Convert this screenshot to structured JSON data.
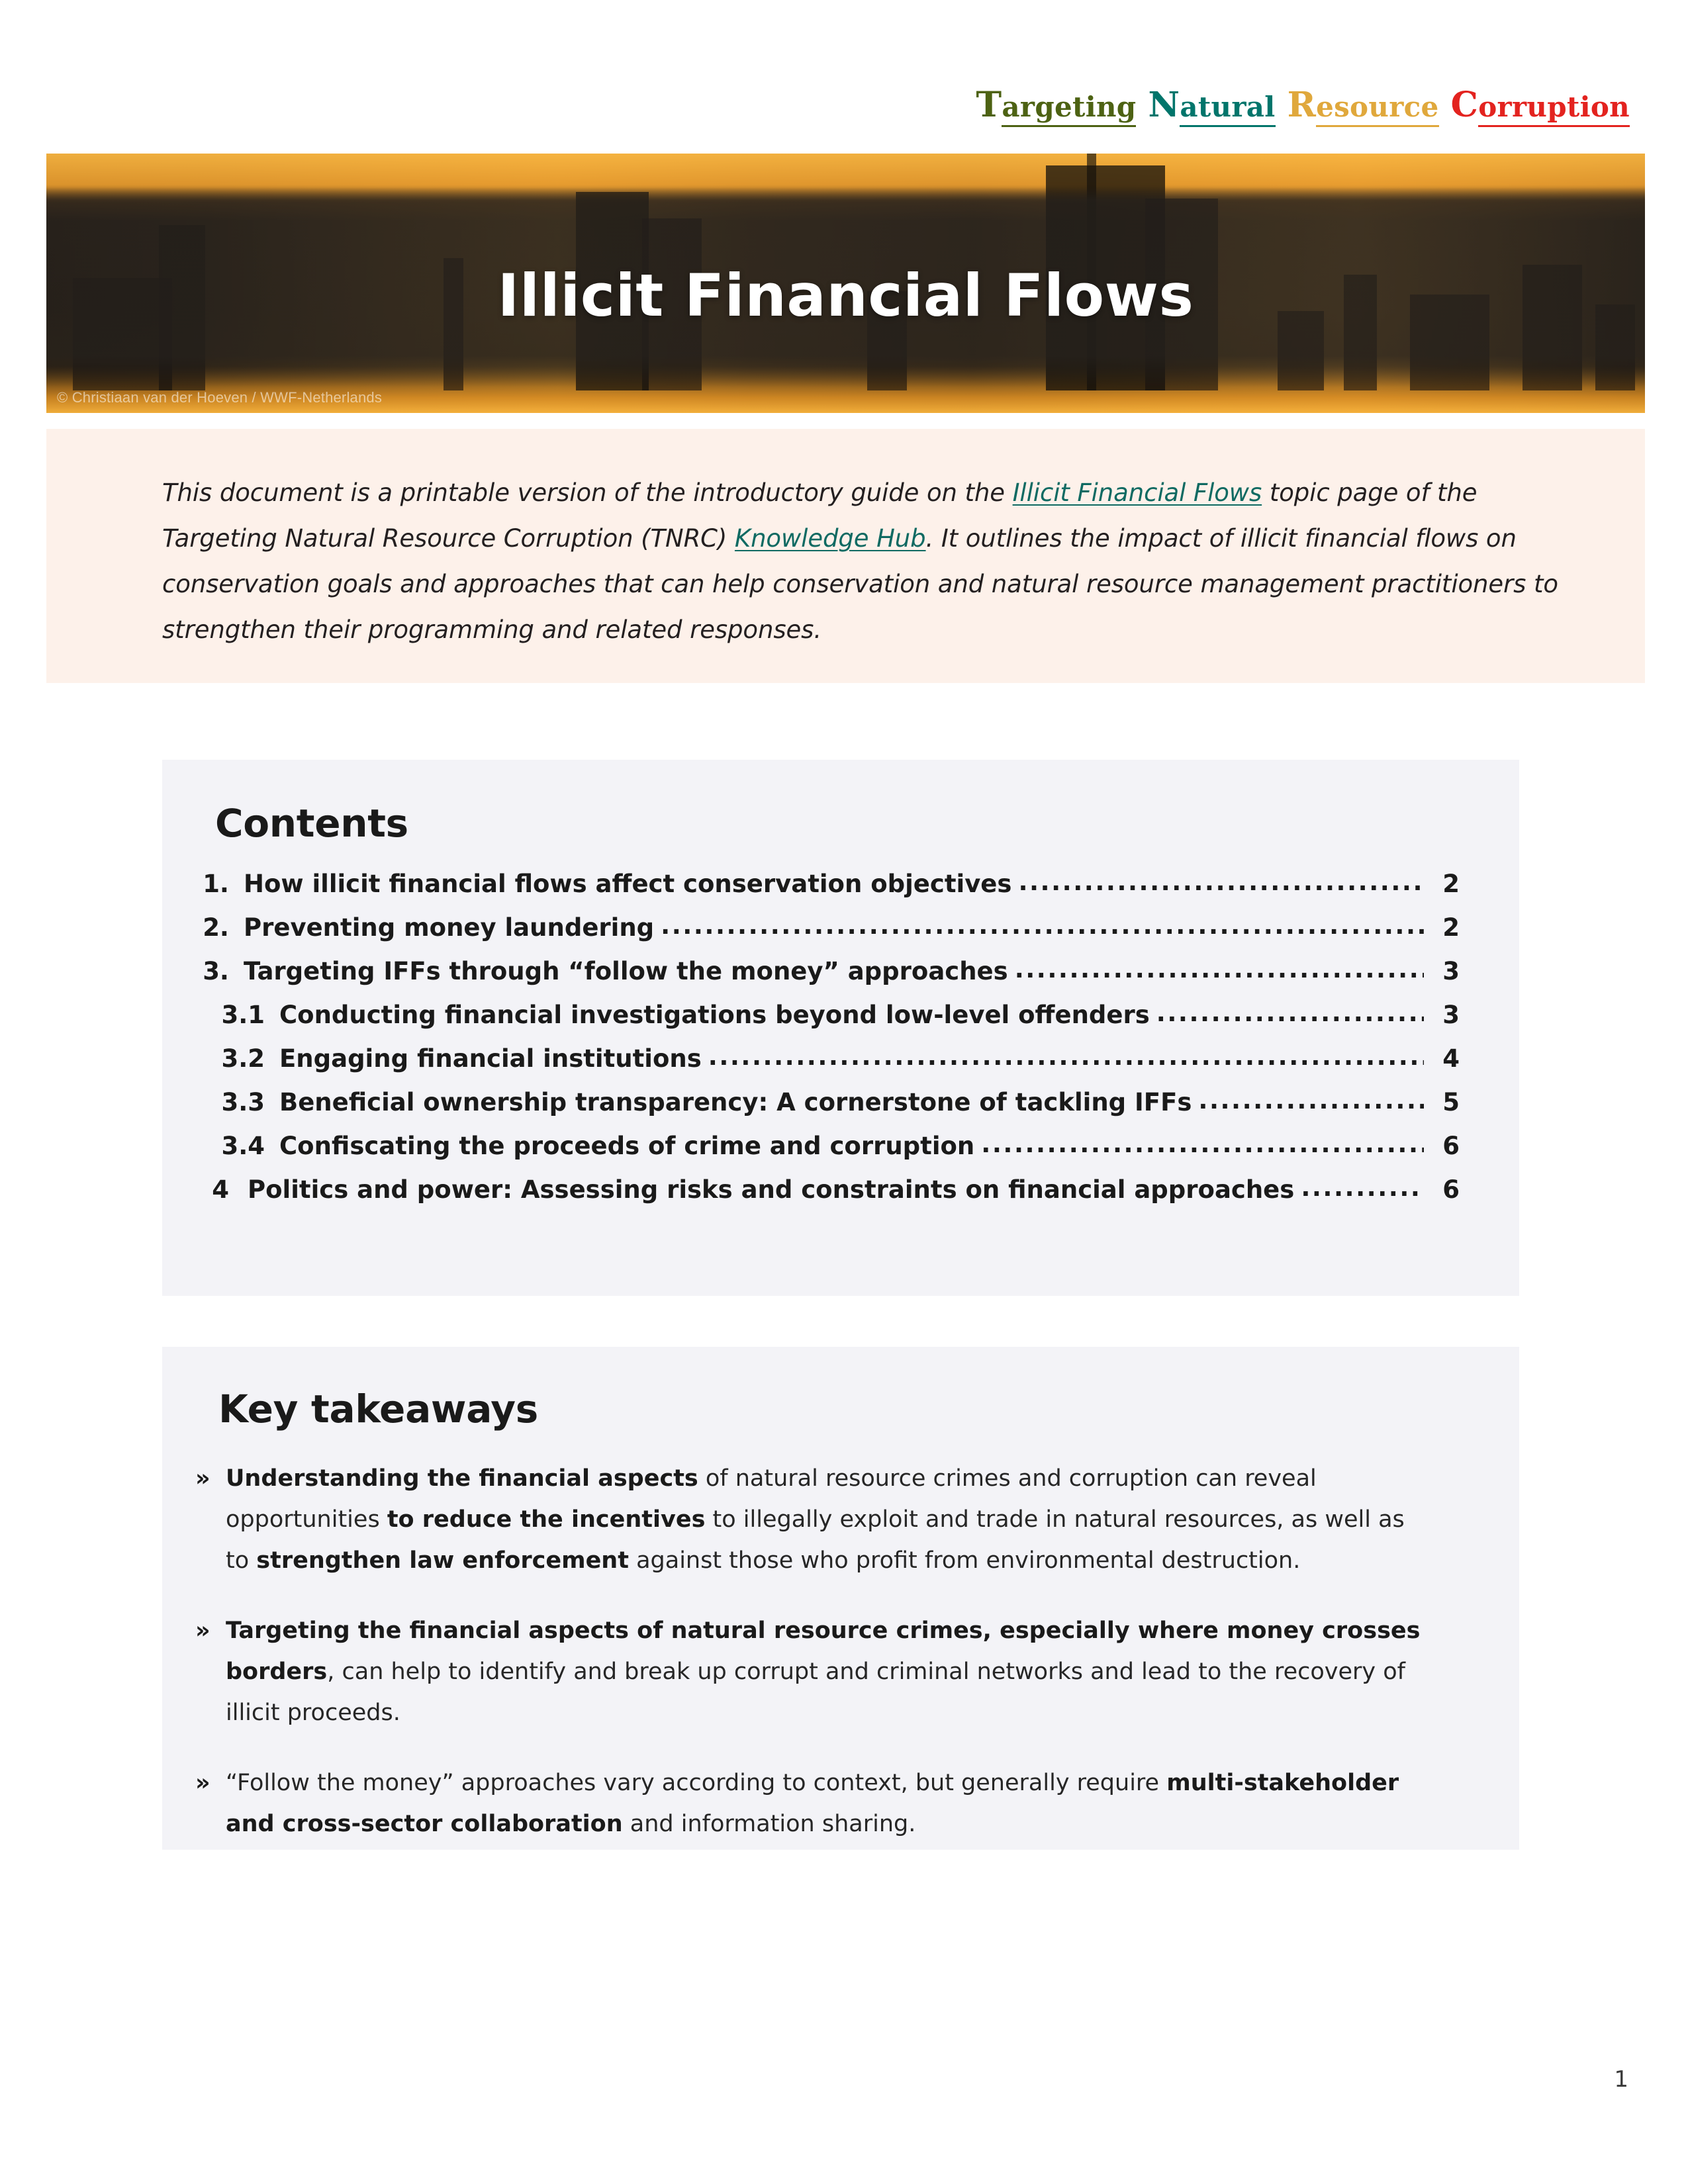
{
  "brand": {
    "words": [
      {
        "cap": "T",
        "rest": "argeting",
        "color": "#4d6213"
      },
      {
        "cap": "N",
        "rest": "atural",
        "color": "#00756b"
      },
      {
        "cap": "R",
        "rest": "esource",
        "color": "#e0a83c"
      },
      {
        "cap": "C",
        "rest": "orruption",
        "color": "#e3231f"
      }
    ],
    "full_text": "Targeting Natural Resource Corruption"
  },
  "hero": {
    "title": "Illicit Financial Flows",
    "photo_credit": "© Christiaan van der Hoeven / WWF-Netherlands"
  },
  "intro": {
    "seg1": "This document is a printable version of the introductory guide on the ",
    "link1": "Illicit Financial Flows",
    "seg2": " topic page of the Targeting Natural Resource Corruption (TNRC) ",
    "link2": "Knowledge Hub",
    "seg3": ". It outlines the impact of illicit financial flows on conservation goals and approaches that can help conservation and natural resource management practitioners to strengthen their programming and related responses.",
    "background": "#fdf1ea"
  },
  "contents": {
    "title": "Contents",
    "dots": "...........................................................................................................................................................................",
    "items": [
      {
        "level": 1,
        "number": "1.",
        "label": "How illicit financial flows affect conservation objectives",
        "page": "2"
      },
      {
        "level": 1,
        "number": "2.",
        "label": "Preventing money laundering",
        "page": "2"
      },
      {
        "level": 1,
        "number": "3.",
        "label": "Targeting IFFs through “follow the money” approaches",
        "page": "3"
      },
      {
        "level": 2,
        "number": "3.1",
        "label": "Conducting financial investigations beyond low-level offenders",
        "page": "3"
      },
      {
        "level": 2,
        "number": "3.2",
        "label": "Engaging financial institutions",
        "page": "4"
      },
      {
        "level": 2,
        "number": "3.3",
        "label": "Beneficial ownership transparency: A cornerstone of tackling IFFs",
        "page": "5"
      },
      {
        "level": 2,
        "number": "3.4",
        "label": "Confiscating the proceeds of crime and corruption",
        "page": "6"
      },
      {
        "level": 3,
        "number": "4",
        "label": "Politics and power: Assessing risks and constraints on financial approaches",
        "page": "6"
      }
    ]
  },
  "takeaways": {
    "title": "Key takeaways",
    "marker": "»",
    "items": [
      {
        "parts": [
          {
            "bold": true,
            "text": "Understanding the financial aspects"
          },
          {
            "bold": false,
            "text": " of natural resource crimes and corruption can reveal opportunities "
          },
          {
            "bold": true,
            "text": "to reduce the incentives"
          },
          {
            "bold": false,
            "text": " to illegally exploit and trade in natural resources, as well as to "
          },
          {
            "bold": true,
            "text": "strengthen law enforcement"
          },
          {
            "bold": false,
            "text": " against those who profit from environmental destruction."
          }
        ]
      },
      {
        "parts": [
          {
            "bold": true,
            "text": "Targeting the financial aspects of natural resource crimes, especially where money crosses borders"
          },
          {
            "bold": false,
            "text": ", can help to identify and break up corrupt and criminal networks and lead to the recovery of illicit proceeds."
          }
        ]
      },
      {
        "parts": [
          {
            "bold": false,
            "text": "“Follow the money” approaches vary according to context, but generally require "
          },
          {
            "bold": true,
            "text": "multi-stakeholder and cross-sector collaboration"
          },
          {
            "bold": false,
            "text": " and information sharing."
          }
        ]
      }
    ]
  },
  "footer": {
    "page_number": "1"
  }
}
